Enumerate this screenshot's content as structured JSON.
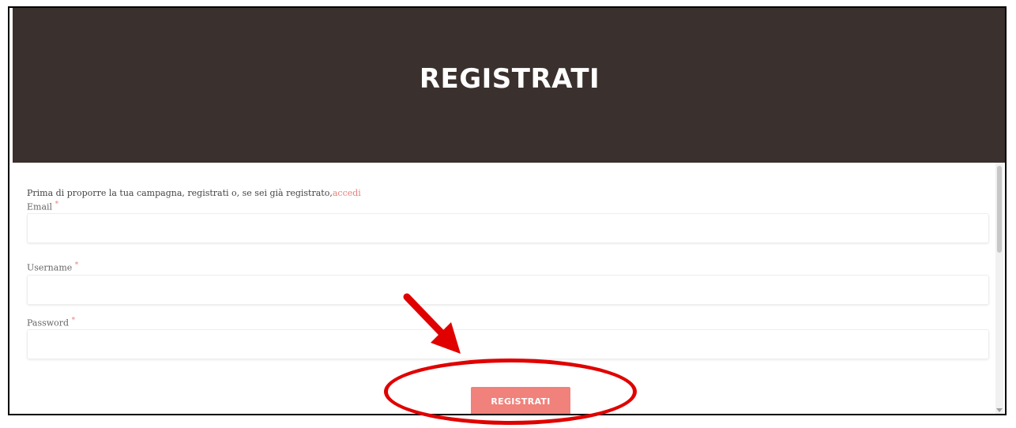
{
  "header": {
    "title": "REGISTRATI"
  },
  "form": {
    "intro_text": "Prima di proporre la tua campagna, registrati o, se sei già registrato,",
    "intro_link": "accedi",
    "fields": [
      {
        "label": "Email",
        "required_mark": "*",
        "value": "",
        "placeholder": ""
      },
      {
        "label": "Username",
        "required_mark": "*",
        "value": "",
        "placeholder": ""
      },
      {
        "label": "Password",
        "required_mark": "*",
        "value": "",
        "placeholder": ""
      }
    ],
    "submit_label": "REGISTRATI"
  },
  "colors": {
    "hero_background": "#3a302d",
    "accent": "#f0817b",
    "annotation": "#e00000"
  },
  "icons": {
    "annotation_arrow": "red-arrow-icon",
    "annotation_circle": "red-ellipse-highlight"
  }
}
